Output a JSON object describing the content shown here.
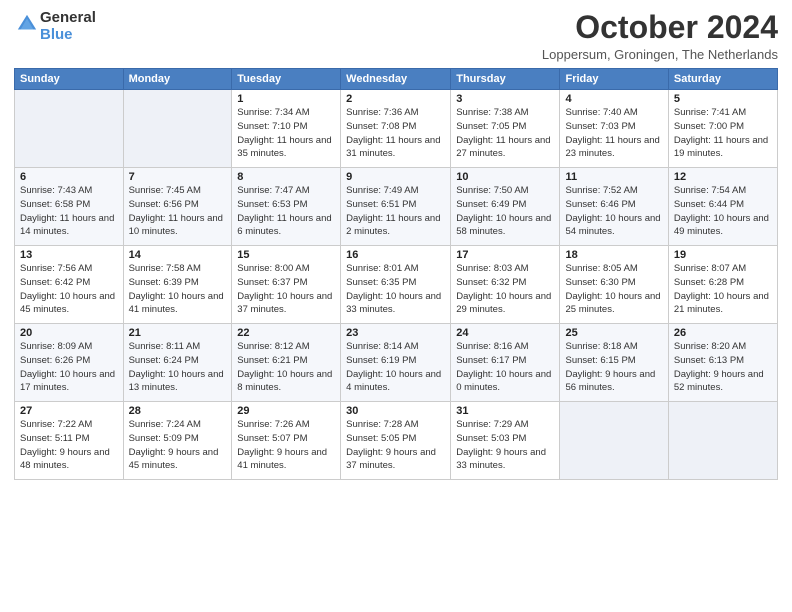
{
  "header": {
    "logo_line1": "General",
    "logo_line2": "Blue",
    "title": "October 2024",
    "location": "Loppersum, Groningen, The Netherlands"
  },
  "weekdays": [
    "Sunday",
    "Monday",
    "Tuesday",
    "Wednesday",
    "Thursday",
    "Friday",
    "Saturday"
  ],
  "weeks": [
    [
      {
        "day": "",
        "sunrise": "",
        "sunset": "",
        "daylight": ""
      },
      {
        "day": "",
        "sunrise": "",
        "sunset": "",
        "daylight": ""
      },
      {
        "day": "1",
        "sunrise": "Sunrise: 7:34 AM",
        "sunset": "Sunset: 7:10 PM",
        "daylight": "Daylight: 11 hours and 35 minutes."
      },
      {
        "day": "2",
        "sunrise": "Sunrise: 7:36 AM",
        "sunset": "Sunset: 7:08 PM",
        "daylight": "Daylight: 11 hours and 31 minutes."
      },
      {
        "day": "3",
        "sunrise": "Sunrise: 7:38 AM",
        "sunset": "Sunset: 7:05 PM",
        "daylight": "Daylight: 11 hours and 27 minutes."
      },
      {
        "day": "4",
        "sunrise": "Sunrise: 7:40 AM",
        "sunset": "Sunset: 7:03 PM",
        "daylight": "Daylight: 11 hours and 23 minutes."
      },
      {
        "day": "5",
        "sunrise": "Sunrise: 7:41 AM",
        "sunset": "Sunset: 7:00 PM",
        "daylight": "Daylight: 11 hours and 19 minutes."
      }
    ],
    [
      {
        "day": "6",
        "sunrise": "Sunrise: 7:43 AM",
        "sunset": "Sunset: 6:58 PM",
        "daylight": "Daylight: 11 hours and 14 minutes."
      },
      {
        "day": "7",
        "sunrise": "Sunrise: 7:45 AM",
        "sunset": "Sunset: 6:56 PM",
        "daylight": "Daylight: 11 hours and 10 minutes."
      },
      {
        "day": "8",
        "sunrise": "Sunrise: 7:47 AM",
        "sunset": "Sunset: 6:53 PM",
        "daylight": "Daylight: 11 hours and 6 minutes."
      },
      {
        "day": "9",
        "sunrise": "Sunrise: 7:49 AM",
        "sunset": "Sunset: 6:51 PM",
        "daylight": "Daylight: 11 hours and 2 minutes."
      },
      {
        "day": "10",
        "sunrise": "Sunrise: 7:50 AM",
        "sunset": "Sunset: 6:49 PM",
        "daylight": "Daylight: 10 hours and 58 minutes."
      },
      {
        "day": "11",
        "sunrise": "Sunrise: 7:52 AM",
        "sunset": "Sunset: 6:46 PM",
        "daylight": "Daylight: 10 hours and 54 minutes."
      },
      {
        "day": "12",
        "sunrise": "Sunrise: 7:54 AM",
        "sunset": "Sunset: 6:44 PM",
        "daylight": "Daylight: 10 hours and 49 minutes."
      }
    ],
    [
      {
        "day": "13",
        "sunrise": "Sunrise: 7:56 AM",
        "sunset": "Sunset: 6:42 PM",
        "daylight": "Daylight: 10 hours and 45 minutes."
      },
      {
        "day": "14",
        "sunrise": "Sunrise: 7:58 AM",
        "sunset": "Sunset: 6:39 PM",
        "daylight": "Daylight: 10 hours and 41 minutes."
      },
      {
        "day": "15",
        "sunrise": "Sunrise: 8:00 AM",
        "sunset": "Sunset: 6:37 PM",
        "daylight": "Daylight: 10 hours and 37 minutes."
      },
      {
        "day": "16",
        "sunrise": "Sunrise: 8:01 AM",
        "sunset": "Sunset: 6:35 PM",
        "daylight": "Daylight: 10 hours and 33 minutes."
      },
      {
        "day": "17",
        "sunrise": "Sunrise: 8:03 AM",
        "sunset": "Sunset: 6:32 PM",
        "daylight": "Daylight: 10 hours and 29 minutes."
      },
      {
        "day": "18",
        "sunrise": "Sunrise: 8:05 AM",
        "sunset": "Sunset: 6:30 PM",
        "daylight": "Daylight: 10 hours and 25 minutes."
      },
      {
        "day": "19",
        "sunrise": "Sunrise: 8:07 AM",
        "sunset": "Sunset: 6:28 PM",
        "daylight": "Daylight: 10 hours and 21 minutes."
      }
    ],
    [
      {
        "day": "20",
        "sunrise": "Sunrise: 8:09 AM",
        "sunset": "Sunset: 6:26 PM",
        "daylight": "Daylight: 10 hours and 17 minutes."
      },
      {
        "day": "21",
        "sunrise": "Sunrise: 8:11 AM",
        "sunset": "Sunset: 6:24 PM",
        "daylight": "Daylight: 10 hours and 13 minutes."
      },
      {
        "day": "22",
        "sunrise": "Sunrise: 8:12 AM",
        "sunset": "Sunset: 6:21 PM",
        "daylight": "Daylight: 10 hours and 8 minutes."
      },
      {
        "day": "23",
        "sunrise": "Sunrise: 8:14 AM",
        "sunset": "Sunset: 6:19 PM",
        "daylight": "Daylight: 10 hours and 4 minutes."
      },
      {
        "day": "24",
        "sunrise": "Sunrise: 8:16 AM",
        "sunset": "Sunset: 6:17 PM",
        "daylight": "Daylight: 10 hours and 0 minutes."
      },
      {
        "day": "25",
        "sunrise": "Sunrise: 8:18 AM",
        "sunset": "Sunset: 6:15 PM",
        "daylight": "Daylight: 9 hours and 56 minutes."
      },
      {
        "day": "26",
        "sunrise": "Sunrise: 8:20 AM",
        "sunset": "Sunset: 6:13 PM",
        "daylight": "Daylight: 9 hours and 52 minutes."
      }
    ],
    [
      {
        "day": "27",
        "sunrise": "Sunrise: 7:22 AM",
        "sunset": "Sunset: 5:11 PM",
        "daylight": "Daylight: 9 hours and 48 minutes."
      },
      {
        "day": "28",
        "sunrise": "Sunrise: 7:24 AM",
        "sunset": "Sunset: 5:09 PM",
        "daylight": "Daylight: 9 hours and 45 minutes."
      },
      {
        "day": "29",
        "sunrise": "Sunrise: 7:26 AM",
        "sunset": "Sunset: 5:07 PM",
        "daylight": "Daylight: 9 hours and 41 minutes."
      },
      {
        "day": "30",
        "sunrise": "Sunrise: 7:28 AM",
        "sunset": "Sunset: 5:05 PM",
        "daylight": "Daylight: 9 hours and 37 minutes."
      },
      {
        "day": "31",
        "sunrise": "Sunrise: 7:29 AM",
        "sunset": "Sunset: 5:03 PM",
        "daylight": "Daylight: 9 hours and 33 minutes."
      },
      {
        "day": "",
        "sunrise": "",
        "sunset": "",
        "daylight": ""
      },
      {
        "day": "",
        "sunrise": "",
        "sunset": "",
        "daylight": ""
      }
    ]
  ]
}
